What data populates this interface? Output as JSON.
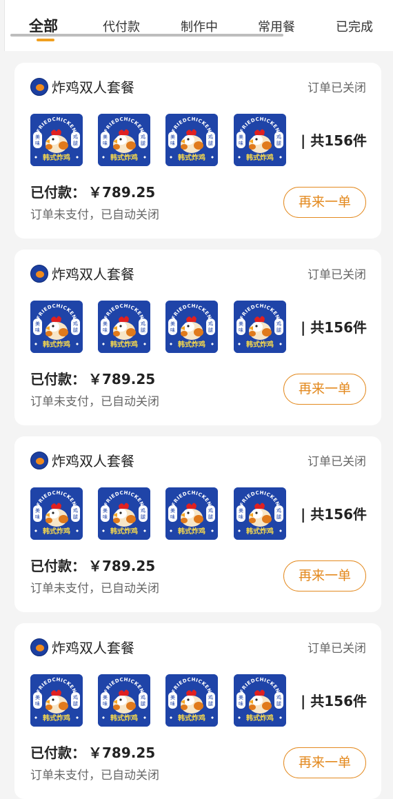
{
  "tabs": [
    {
      "label": "全部",
      "active": true
    },
    {
      "label": "代付款",
      "active": false
    },
    {
      "label": "制作中",
      "active": false
    },
    {
      "label": "常用餐",
      "active": false
    },
    {
      "label": "已完成",
      "active": false
    }
  ],
  "colors": {
    "accent": "#e3891e",
    "tab_indicator": "#f0a020",
    "thumb_blue": "#1f44a8",
    "page_bg": "#f4f4f4"
  },
  "thumbnail_art": {
    "top_text": "FRIEDCHICKEN",
    "side_left": "美味",
    "side_right": "鸡腿",
    "banner": "韩式炸鸡"
  },
  "orders": [
    {
      "store_name": "炸鸡双人套餐",
      "status": "订单已关闭",
      "item_count": "| 共156件",
      "paid_label": "已付款：",
      "paid_amount": "￥789.25",
      "note": "订单未支付，已自动关闭",
      "reorder_label": "再来一单",
      "thumb_count": 4
    },
    {
      "store_name": "炸鸡双人套餐",
      "status": "订单已关闭",
      "item_count": "| 共156件",
      "paid_label": "已付款：",
      "paid_amount": "￥789.25",
      "note": "订单未支付，已自动关闭",
      "reorder_label": "再来一单",
      "thumb_count": 4
    },
    {
      "store_name": "炸鸡双人套餐",
      "status": "订单已关闭",
      "item_count": "| 共156件",
      "paid_label": "已付款：",
      "paid_amount": "￥789.25",
      "note": "订单未支付，已自动关闭",
      "reorder_label": "再来一单",
      "thumb_count": 4
    },
    {
      "store_name": "炸鸡双人套餐",
      "status": "订单已关闭",
      "item_count": "| 共156件",
      "paid_label": "已付款：",
      "paid_amount": "￥789.25",
      "note": "订单未支付，已自动关闭",
      "reorder_label": "再来一单",
      "thumb_count": 4
    }
  ]
}
